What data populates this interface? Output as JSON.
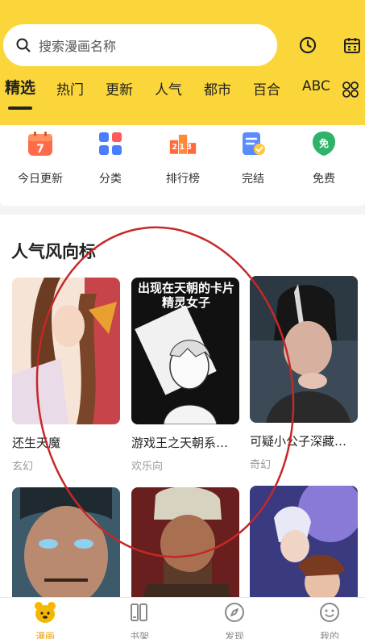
{
  "search": {
    "placeholder": "搜索漫画名称"
  },
  "header_icons": [
    "clock-icon",
    "calendar-icon"
  ],
  "tabs": [
    {
      "label": "精选",
      "active": true
    },
    {
      "label": "热门"
    },
    {
      "label": "更新"
    },
    {
      "label": "人气"
    },
    {
      "label": "都市"
    },
    {
      "label": "百合"
    },
    {
      "label": "ABC"
    }
  ],
  "categories": [
    {
      "label": "今日更新",
      "icon": "calendar-7-icon"
    },
    {
      "label": "分类",
      "icon": "category-icon"
    },
    {
      "label": "排行榜",
      "icon": "podium-icon"
    },
    {
      "label": "完结",
      "icon": "finished-icon"
    },
    {
      "label": "免费",
      "icon": "free-icon",
      "icon_text": "免"
    }
  ],
  "calendar_day": "7",
  "podium_text": "213",
  "section": {
    "title": "人气风向标",
    "comics": [
      {
        "title": "还生天魔",
        "genre": "玄幻"
      },
      {
        "title": "游戏王之天朝系…",
        "genre": "欢乐向",
        "cover_text": "出现在天朝的卡片精灵女子"
      },
      {
        "title": "可疑小公子深藏…",
        "genre": "奇幻"
      },
      {
        "title": "",
        "genre": ""
      },
      {
        "title": "",
        "genre": ""
      },
      {
        "title": "",
        "genre": ""
      }
    ]
  },
  "bottom_nav": [
    {
      "label": "漫画",
      "active": true
    },
    {
      "label": "书架"
    },
    {
      "label": "发现"
    },
    {
      "label": "我的"
    }
  ],
  "colors": {
    "header": "#fbd63a",
    "accent": "#f0a000",
    "annotation": "#c62828"
  }
}
